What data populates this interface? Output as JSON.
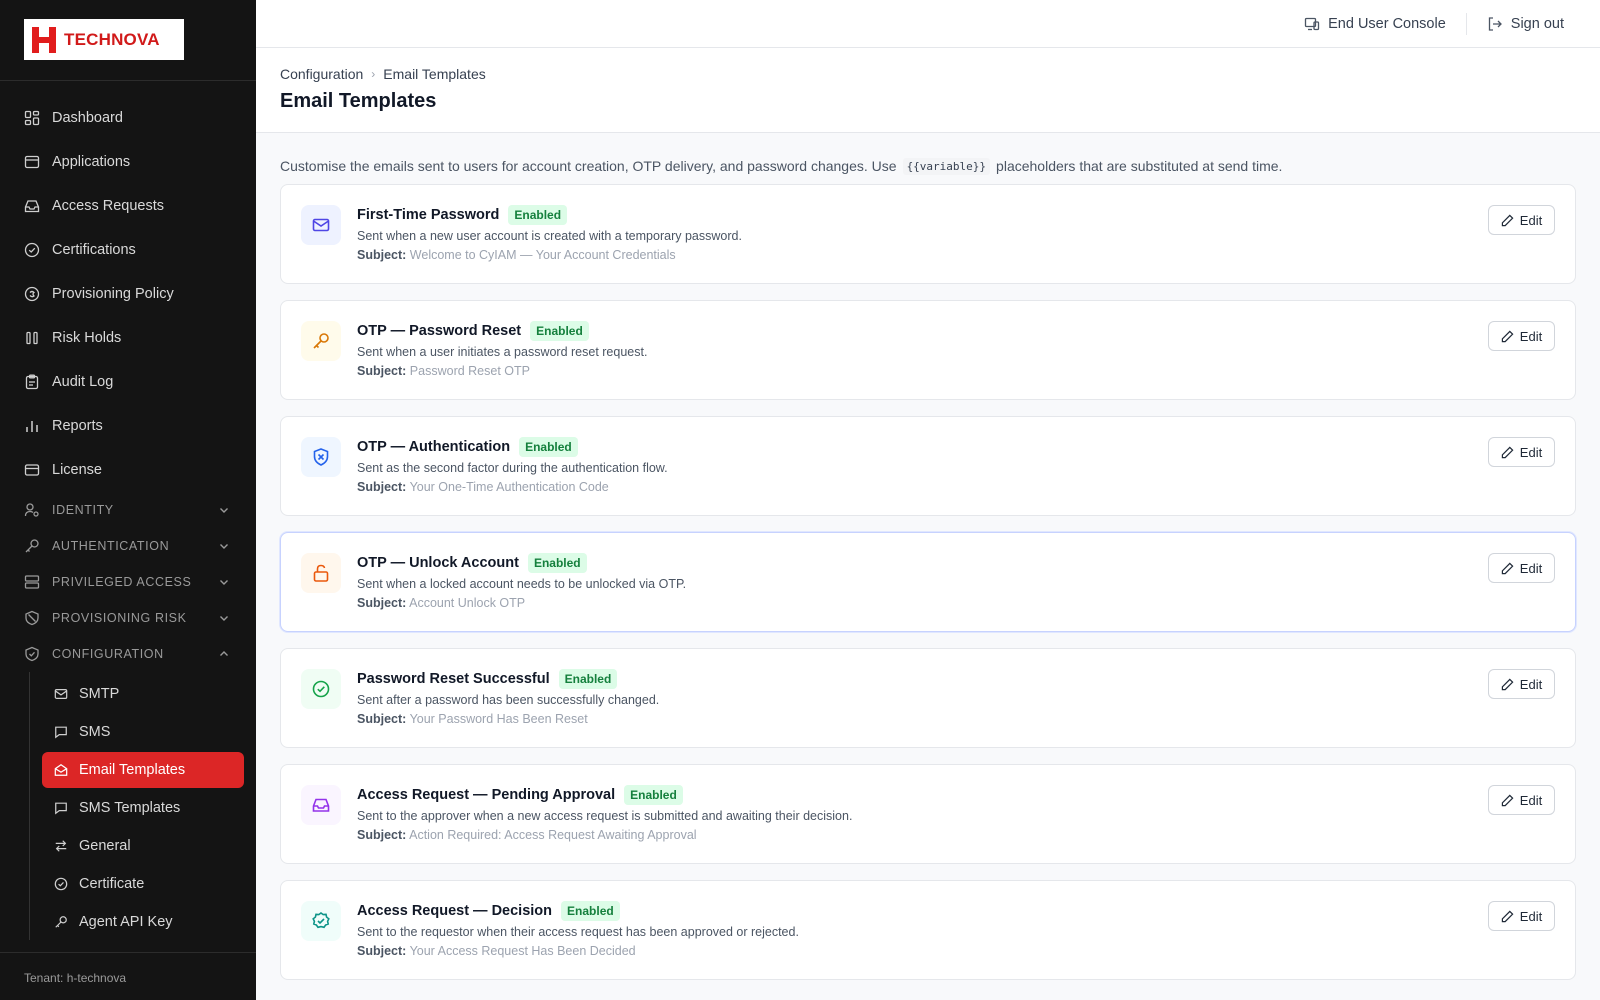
{
  "brand": {
    "name": "TECHNOVA"
  },
  "sidebar": {
    "items": [
      {
        "label": "Dashboard",
        "icon": "dashboard-icon"
      },
      {
        "label": "Applications",
        "icon": "window-icon"
      },
      {
        "label": "Access Requests",
        "icon": "inbox-icon"
      },
      {
        "label": "Certifications",
        "icon": "check-circle-icon"
      },
      {
        "label": "Provisioning Policy",
        "icon": "policy-icon"
      },
      {
        "label": "Risk Holds",
        "icon": "pause-icon"
      },
      {
        "label": "Audit Log",
        "icon": "clipboard-icon"
      },
      {
        "label": "Reports",
        "icon": "bar-chart-icon"
      },
      {
        "label": "License",
        "icon": "card-icon"
      }
    ],
    "groups": [
      {
        "label": "Identity",
        "icon": "user-cog-icon"
      },
      {
        "label": "Authentication",
        "icon": "key-icon"
      },
      {
        "label": "Privileged Access",
        "icon": "server-icon"
      },
      {
        "label": "Provisioning Risk",
        "icon": "ban-icon"
      },
      {
        "label": "Configuration",
        "icon": "shield-check-icon"
      }
    ],
    "config_items": [
      {
        "label": "SMTP",
        "icon": "mail-icon"
      },
      {
        "label": "SMS",
        "icon": "message-icon"
      },
      {
        "label": "Email Templates",
        "icon": "mail-open-icon"
      },
      {
        "label": "SMS Templates",
        "icon": "message-icon"
      },
      {
        "label": "General",
        "icon": "arrows-icon"
      },
      {
        "label": "Certificate",
        "icon": "check-circle-icon"
      },
      {
        "label": "Agent API Key",
        "icon": "key-icon"
      }
    ],
    "tenant": "Tenant: h-technova"
  },
  "topbar": {
    "end_user_console": "End User Console",
    "sign_out": "Sign out"
  },
  "breadcrumb": {
    "parent": "Configuration",
    "current": "Email Templates"
  },
  "page_title": "Email Templates",
  "intro": {
    "before": "Customise the emails sent to users for account creation, OTP delivery, and password changes. Use",
    "code": "{{variable}}",
    "after": "placeholders that are substituted at send time."
  },
  "subject_label": "Subject:",
  "edit_label": "Edit",
  "templates": [
    {
      "title": "First-Time Password",
      "status": "Enabled",
      "description": "Sent when a new user account is created with a temporary password.",
      "subject": "Welcome to CyIAM — Your Account Credentials",
      "icon": "mail-icon",
      "color": "#4f46e5",
      "bg": "#eef2ff"
    },
    {
      "title": "OTP — Password Reset",
      "status": "Enabled",
      "description": "Sent when a user initiates a password reset request.",
      "subject": "Password Reset OTP",
      "icon": "key-icon",
      "color": "#d97706",
      "bg": "#fffbeb"
    },
    {
      "title": "OTP — Authentication",
      "status": "Enabled",
      "description": "Sent as the second factor during the authentication flow.",
      "subject": "Your One-Time Authentication Code",
      "icon": "shield-x-icon",
      "color": "#2563eb",
      "bg": "#eff6ff"
    },
    {
      "title": "OTP — Unlock Account",
      "status": "Enabled",
      "description": "Sent when a locked account needs to be unlocked via OTP.",
      "subject": "Account Unlock OTP",
      "icon": "unlock-icon",
      "color": "#ea580c",
      "bg": "#fff7ed"
    },
    {
      "title": "Password Reset Successful",
      "status": "Enabled",
      "description": "Sent after a password has been successfully changed.",
      "subject": "Your Password Has Been Reset",
      "icon": "check-circle-icon",
      "color": "#16a34a",
      "bg": "#f0fdf4"
    },
    {
      "title": "Access Request — Pending Approval",
      "status": "Enabled",
      "description": "Sent to the approver when a new access request is submitted and awaiting their decision.",
      "subject": "Action Required: Access Request Awaiting Approval",
      "icon": "inbox-icon",
      "color": "#9333ea",
      "bg": "#faf5ff"
    },
    {
      "title": "Access Request — Decision",
      "status": "Enabled",
      "description": "Sent to the requestor when their access request has been approved or rejected.",
      "subject": "Your Access Request Has Been Decided",
      "icon": "check-badge-icon",
      "color": "#0d9488",
      "bg": "#f0fdfa"
    }
  ]
}
